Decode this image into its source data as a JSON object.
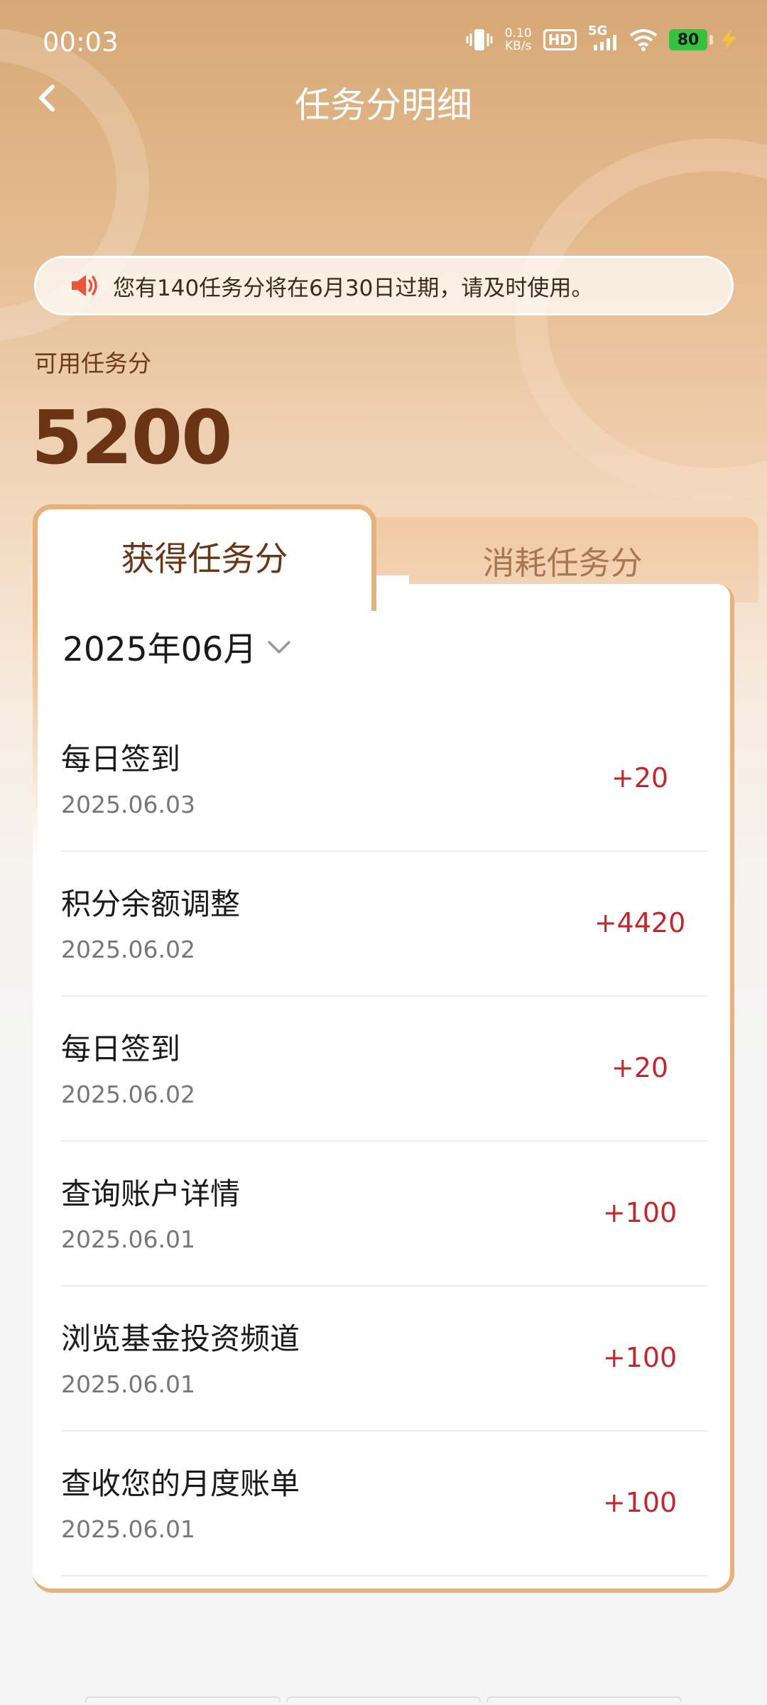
{
  "status_bar": {
    "time": "00:03",
    "net_speed_value": "0.10",
    "net_speed_unit": "KB/s",
    "hd_label": "HD",
    "network_label": "5G",
    "battery_level": "80"
  },
  "header": {
    "title": "任务分明细"
  },
  "notice": {
    "text": "您有140任务分将在6月30日过期，请及时使用。"
  },
  "summary": {
    "label": "可用任务分",
    "value": "5200"
  },
  "tabs": [
    {
      "label": "获得任务分",
      "active": true
    },
    {
      "label": "消耗任务分",
      "active": false
    }
  ],
  "month_picker": {
    "label": "2025年06月"
  },
  "records": [
    {
      "title": "每日签到",
      "date": "2025.06.03",
      "points": "+20"
    },
    {
      "title": "积分余额调整",
      "date": "2025.06.02",
      "points": "+4420"
    },
    {
      "title": "每日签到",
      "date": "2025.06.02",
      "points": "+20"
    },
    {
      "title": "查询账户详情",
      "date": "2025.06.01",
      "points": "+100"
    },
    {
      "title": "浏览基金投资频道",
      "date": "2025.06.01",
      "points": "+100"
    },
    {
      "title": "查收您的月度账单",
      "date": "2025.06.01",
      "points": "+100"
    }
  ],
  "colors": {
    "accent_brown": "#6b3416",
    "points_red": "#c0282d",
    "tab_border": "#e8b07a",
    "speaker": "#e8553a"
  }
}
